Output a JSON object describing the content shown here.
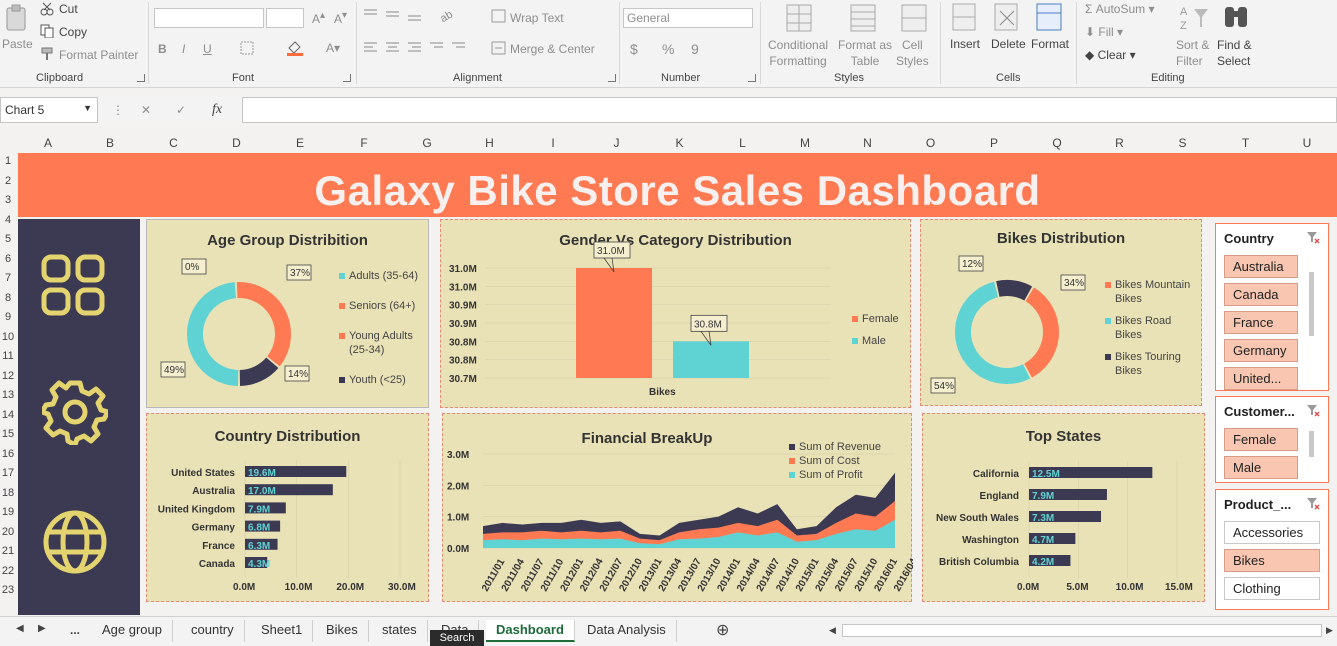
{
  "ribbon": {
    "clipboard": {
      "paste": "Paste",
      "cut": "Cut",
      "copy": "Copy",
      "format_painter": "Format Painter",
      "label": "Clipboard"
    },
    "font": {
      "label": "Font",
      "bold": "B",
      "italic": "I",
      "underline": "U"
    },
    "alignment": {
      "wrap_text": "Wrap Text",
      "merge_center": "Merge & Center",
      "label": "Alignment"
    },
    "number": {
      "format": "General",
      "currency": "$",
      "percent": "%",
      "comma": "9",
      "label": "Number"
    },
    "styles": {
      "conditional": [
        "Conditional",
        "Formatting"
      ],
      "format_table": [
        "Format as",
        "Table"
      ],
      "cell_styles": [
        "Cell",
        "Styles"
      ],
      "label": "Styles"
    },
    "cells": {
      "insert": "Insert",
      "delete": "Delete",
      "format": "Format",
      "label": "Cells"
    },
    "editing": {
      "autosum": "AutoSum",
      "fill": "Fill",
      "clear": "Clear",
      "sort_filter": [
        "Sort &",
        "Filter"
      ],
      "find_select": [
        "Find &",
        "Select"
      ],
      "label": "Editing"
    }
  },
  "formula_bar": {
    "name_box": "Chart 5",
    "fx": "fx",
    "cancel": "✕",
    "enter": "✓"
  },
  "columns": [
    "A",
    "B",
    "C",
    "D",
    "E",
    "F",
    "G",
    "H",
    "I",
    "J",
    "K",
    "L",
    "M",
    "N",
    "O",
    "P",
    "Q",
    "R",
    "S",
    "T",
    "U"
  ],
  "rows": [
    "1",
    "2",
    "3",
    "4",
    "5",
    "6",
    "7",
    "8",
    "9",
    "10",
    "11",
    "12",
    "13",
    "14",
    "15",
    "16",
    "17",
    "18",
    "19",
    "20",
    "21",
    "22",
    "23"
  ],
  "dashboard_title": "Galaxy Bike Store Sales Dashboard",
  "sidebar_icons": [
    "dashboard-grid-icon",
    "gear-icon",
    "globe-icon"
  ],
  "colors": {
    "orange": "#ff7a52",
    "teal": "#5fd3d3",
    "navy": "#3c3a52",
    "panel": "#e9e2b7"
  },
  "chart_data": [
    {
      "type": "pie",
      "title": "Age Group Distribition",
      "categories": [
        "Adults (35-64)",
        "Seniors (64+)",
        "Young Adults (25-34)",
        "Youth (<25)"
      ],
      "values": [
        49,
        0,
        37,
        14
      ],
      "labels": [
        "49%",
        "0%",
        "37%",
        "14%"
      ]
    },
    {
      "type": "bar",
      "title": "Gender Vs Category Distribution",
      "categories": [
        "Bikes"
      ],
      "series": [
        {
          "name": "Female",
          "values": [
            31.0
          ]
        },
        {
          "name": "Male",
          "values": [
            30.8
          ]
        }
      ],
      "data_labels": [
        "31.0M",
        "30.8M"
      ],
      "y_ticks": [
        "31.0M",
        "31.0M",
        "30.9M",
        "30.9M",
        "30.8M",
        "30.8M",
        "30.7M"
      ],
      "ylim": [
        30.7,
        31.0
      ],
      "legend": "right"
    },
    {
      "type": "pie",
      "title": "Bikes Distribution",
      "categories": [
        "Bikes Mountain Bikes",
        "Bikes Road Bikes",
        "Bikes Touring Bikes"
      ],
      "values": [
        34,
        54,
        12
      ],
      "labels": [
        "34%",
        "54%",
        "12%"
      ]
    },
    {
      "type": "bar",
      "title": "Country Distribution",
      "categories": [
        "United States",
        "Australia",
        "United Kingdom",
        "Germany",
        "France",
        "Canada"
      ],
      "values": [
        19.6,
        17.0,
        7.9,
        6.8,
        6.3,
        4.3
      ],
      "data_labels": [
        "19.6M",
        "17.0M",
        "7.9M",
        "6.8M",
        "6.3M",
        "4.3M"
      ],
      "x_ticks": [
        "0.0M",
        "10.0M",
        "20.0M",
        "30.0M"
      ],
      "xlim": [
        0,
        30
      ]
    },
    {
      "type": "area",
      "title": "Financial BreakUp",
      "x": [
        "2011/01",
        "2011/04",
        "2011/07",
        "2011/10",
        "2012/01",
        "2012/04",
        "2012/07",
        "2012/10",
        "2013/01",
        "2013/04",
        "2013/07",
        "2013/10",
        "2014/01",
        "2014/04",
        "2014/07",
        "2014/10",
        "2015/01",
        "2015/04",
        "2015/07",
        "2015/10",
        "2016/01",
        "2016/04"
      ],
      "series": [
        {
          "name": "Sum of Revenue",
          "values": [
            0.7,
            0.8,
            0.75,
            0.8,
            0.8,
            0.9,
            0.8,
            0.85,
            0.45,
            0.4,
            0.8,
            0.9,
            1.0,
            1.3,
            1.1,
            1.4,
            0.6,
            0.7,
            1.3,
            1.7,
            1.6,
            2.4
          ]
        },
        {
          "name": "Sum of Cost",
          "values": [
            0.45,
            0.5,
            0.5,
            0.55,
            0.5,
            0.55,
            0.5,
            0.55,
            0.3,
            0.25,
            0.5,
            0.6,
            0.65,
            0.8,
            0.7,
            0.9,
            0.4,
            0.45,
            0.8,
            1.1,
            1.0,
            1.5
          ]
        },
        {
          "name": "Sum of Profit",
          "values": [
            0.25,
            0.28,
            0.25,
            0.3,
            0.28,
            0.3,
            0.28,
            0.3,
            0.15,
            0.12,
            0.28,
            0.3,
            0.35,
            0.5,
            0.4,
            0.5,
            0.2,
            0.25,
            0.45,
            0.6,
            0.55,
            0.9
          ]
        }
      ],
      "y_ticks": [
        "0.0M",
        "1.0M",
        "2.0M",
        "3.0M"
      ],
      "ylim": [
        0,
        3
      ]
    },
    {
      "type": "bar",
      "title": "Top States",
      "categories": [
        "California",
        "England",
        "New South Wales",
        "Washington",
        "British Columbia"
      ],
      "values": [
        12.5,
        7.9,
        7.3,
        4.7,
        4.2
      ],
      "data_labels": [
        "12.5M",
        "7.9M",
        "7.3M",
        "4.7M",
        "4.2M"
      ],
      "x_ticks": [
        "0.0M",
        "5.0M",
        "10.0M",
        "15.0M"
      ],
      "xlim": [
        0,
        15
      ]
    }
  ],
  "slicers": [
    {
      "title": "Country",
      "items": [
        {
          "label": "Australia",
          "selected": true
        },
        {
          "label": "Canada",
          "selected": true
        },
        {
          "label": "France",
          "selected": true
        },
        {
          "label": "Germany",
          "selected": true
        },
        {
          "label": "United...",
          "selected": true
        }
      ]
    },
    {
      "title": "Customer...",
      "items": [
        {
          "label": "Female",
          "selected": true
        },
        {
          "label": "Male",
          "selected": true
        }
      ]
    },
    {
      "title": "Product_...",
      "items": [
        {
          "label": "Accessories",
          "selected": false
        },
        {
          "label": "Bikes",
          "selected": true
        },
        {
          "label": "Clothing",
          "selected": false
        }
      ]
    }
  ],
  "sheet_tabs": {
    "more": "...",
    "tabs": [
      "Age group",
      "country",
      "Sheet1",
      "Bikes",
      "states",
      "Data",
      "Dashboard",
      "Data Analysis"
    ],
    "active": "Dashboard",
    "tooltip": "Search"
  }
}
